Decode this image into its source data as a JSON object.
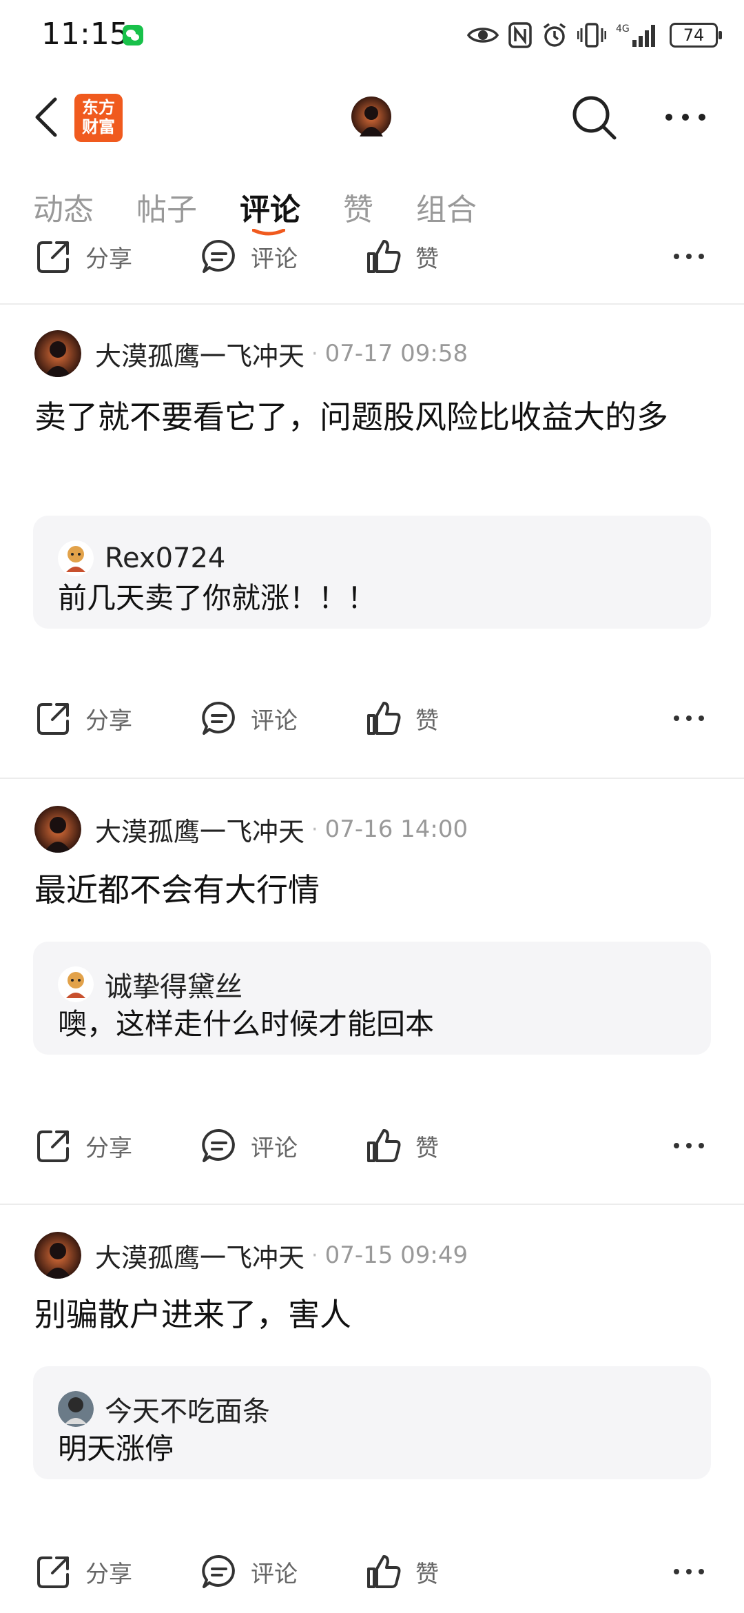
{
  "status_bar": {
    "time": "11:15",
    "battery": "74",
    "network": "4G"
  },
  "header": {
    "brand_line1": "东方",
    "brand_line2": "财富"
  },
  "tabs": [
    {
      "label": "动态"
    },
    {
      "label": "帖子"
    },
    {
      "label": "评论"
    },
    {
      "label": "赞"
    },
    {
      "label": "组合"
    }
  ],
  "actions": {
    "share": "分享",
    "comment": "评论",
    "like": "赞"
  },
  "posts": [
    {
      "author": "大漠孤鹰一飞冲天",
      "time": "07-17 09:58",
      "text": "卖了就不要看它了，问题股风险比收益大的多",
      "quote": {
        "user": "Rex0724",
        "text": "前几天卖了你就涨！！！"
      }
    },
    {
      "author": "大漠孤鹰一飞冲天",
      "time": "07-16 14:00",
      "text": "最近都不会有大行情",
      "quote": {
        "user": "诚挚得黛丝",
        "text": "噢，这样走什么时候才能回本"
      }
    },
    {
      "author": "大漠孤鹰一飞冲天",
      "time": "07-15 09:49",
      "text": "别骗散户进来了，害人",
      "quote": {
        "user": "今天不吃面条",
        "text": "明天涨停"
      }
    }
  ],
  "colors": {
    "accent": "#f05a1e",
    "quote_bg": "#f5f5f7",
    "muted": "#999999"
  }
}
